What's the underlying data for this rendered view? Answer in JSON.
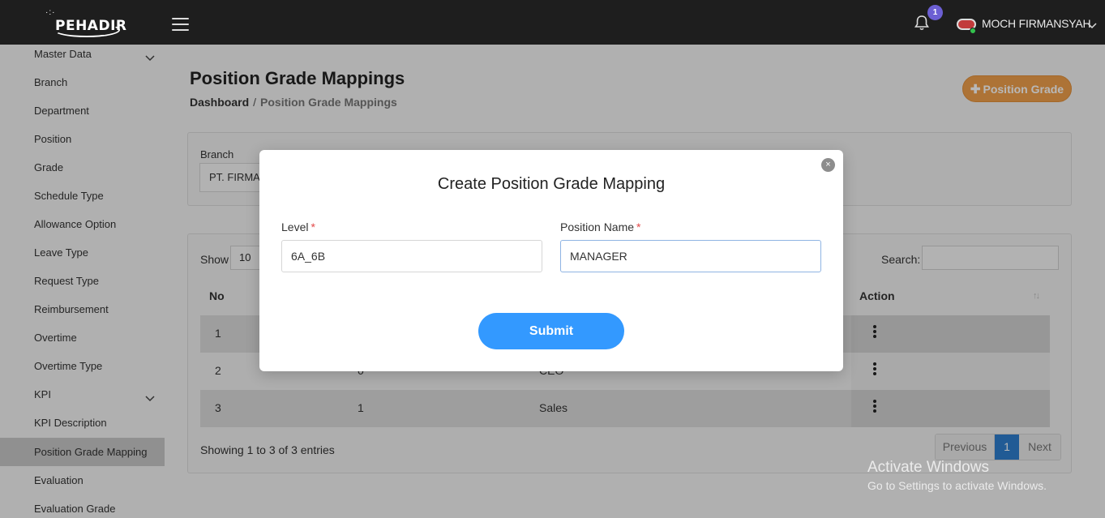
{
  "header": {
    "logo_text": "PEHADIR",
    "notification_count": "1",
    "user_name": "MOCH FIRMANSYAH"
  },
  "sidebar": {
    "items": [
      {
        "label": "Master Data",
        "expandable": true
      },
      {
        "label": "Branch"
      },
      {
        "label": "Department"
      },
      {
        "label": "Position"
      },
      {
        "label": "Grade"
      },
      {
        "label": "Schedule Type"
      },
      {
        "label": "Allowance Option"
      },
      {
        "label": "Leave Type"
      },
      {
        "label": "Request Type"
      },
      {
        "label": "Reimbursement"
      },
      {
        "label": "Overtime"
      },
      {
        "label": "Overtime Type"
      },
      {
        "label": "KPI",
        "expandable": true
      },
      {
        "label": "KPI Description"
      },
      {
        "label": "Position Grade Mapping",
        "active": true
      },
      {
        "label": "Evaluation"
      },
      {
        "label": "Evaluation Grade"
      }
    ]
  },
  "page": {
    "title": "Position Grade Mappings",
    "breadcrumb": [
      "Dashboard",
      "Position Grade Mappings"
    ],
    "breadcrumb_sep": "/",
    "add_button": "Position Grade"
  },
  "filter": {
    "branch_label": "Branch",
    "branch_value": "PT. FIRMA"
  },
  "table": {
    "show_label": "Show",
    "page_size": "10",
    "search_label": "Search:",
    "headers": {
      "no": "No",
      "action": "Action"
    },
    "rows": [
      {
        "no": "1",
        "level": "",
        "position": ""
      },
      {
        "no": "2",
        "level": "0",
        "position": "CEO"
      },
      {
        "no": "3",
        "level": "1",
        "position": "Sales"
      }
    ],
    "info": "Showing 1 to 3 of 3 entries",
    "pagination": {
      "previous": "Previous",
      "current": "1",
      "next": "Next"
    }
  },
  "modal": {
    "title": "Create Position Grade Mapping",
    "close_glyph": "×",
    "level_label": "Level",
    "level_value": "6A_6B",
    "position_label": "Position Name",
    "position_value": "MANAGER",
    "required_mark": "*",
    "submit_label": "Submit"
  },
  "watermark": {
    "line1": "Activate Windows",
    "line2": "Go to Settings to activate Windows."
  },
  "colors": {
    "topbar": "#1e1e1e",
    "accent_orange": "#f0a04b",
    "submit_blue": "#3399ff",
    "pager_active": "#2f7fcf",
    "badge_purple": "#6c5fd3"
  }
}
